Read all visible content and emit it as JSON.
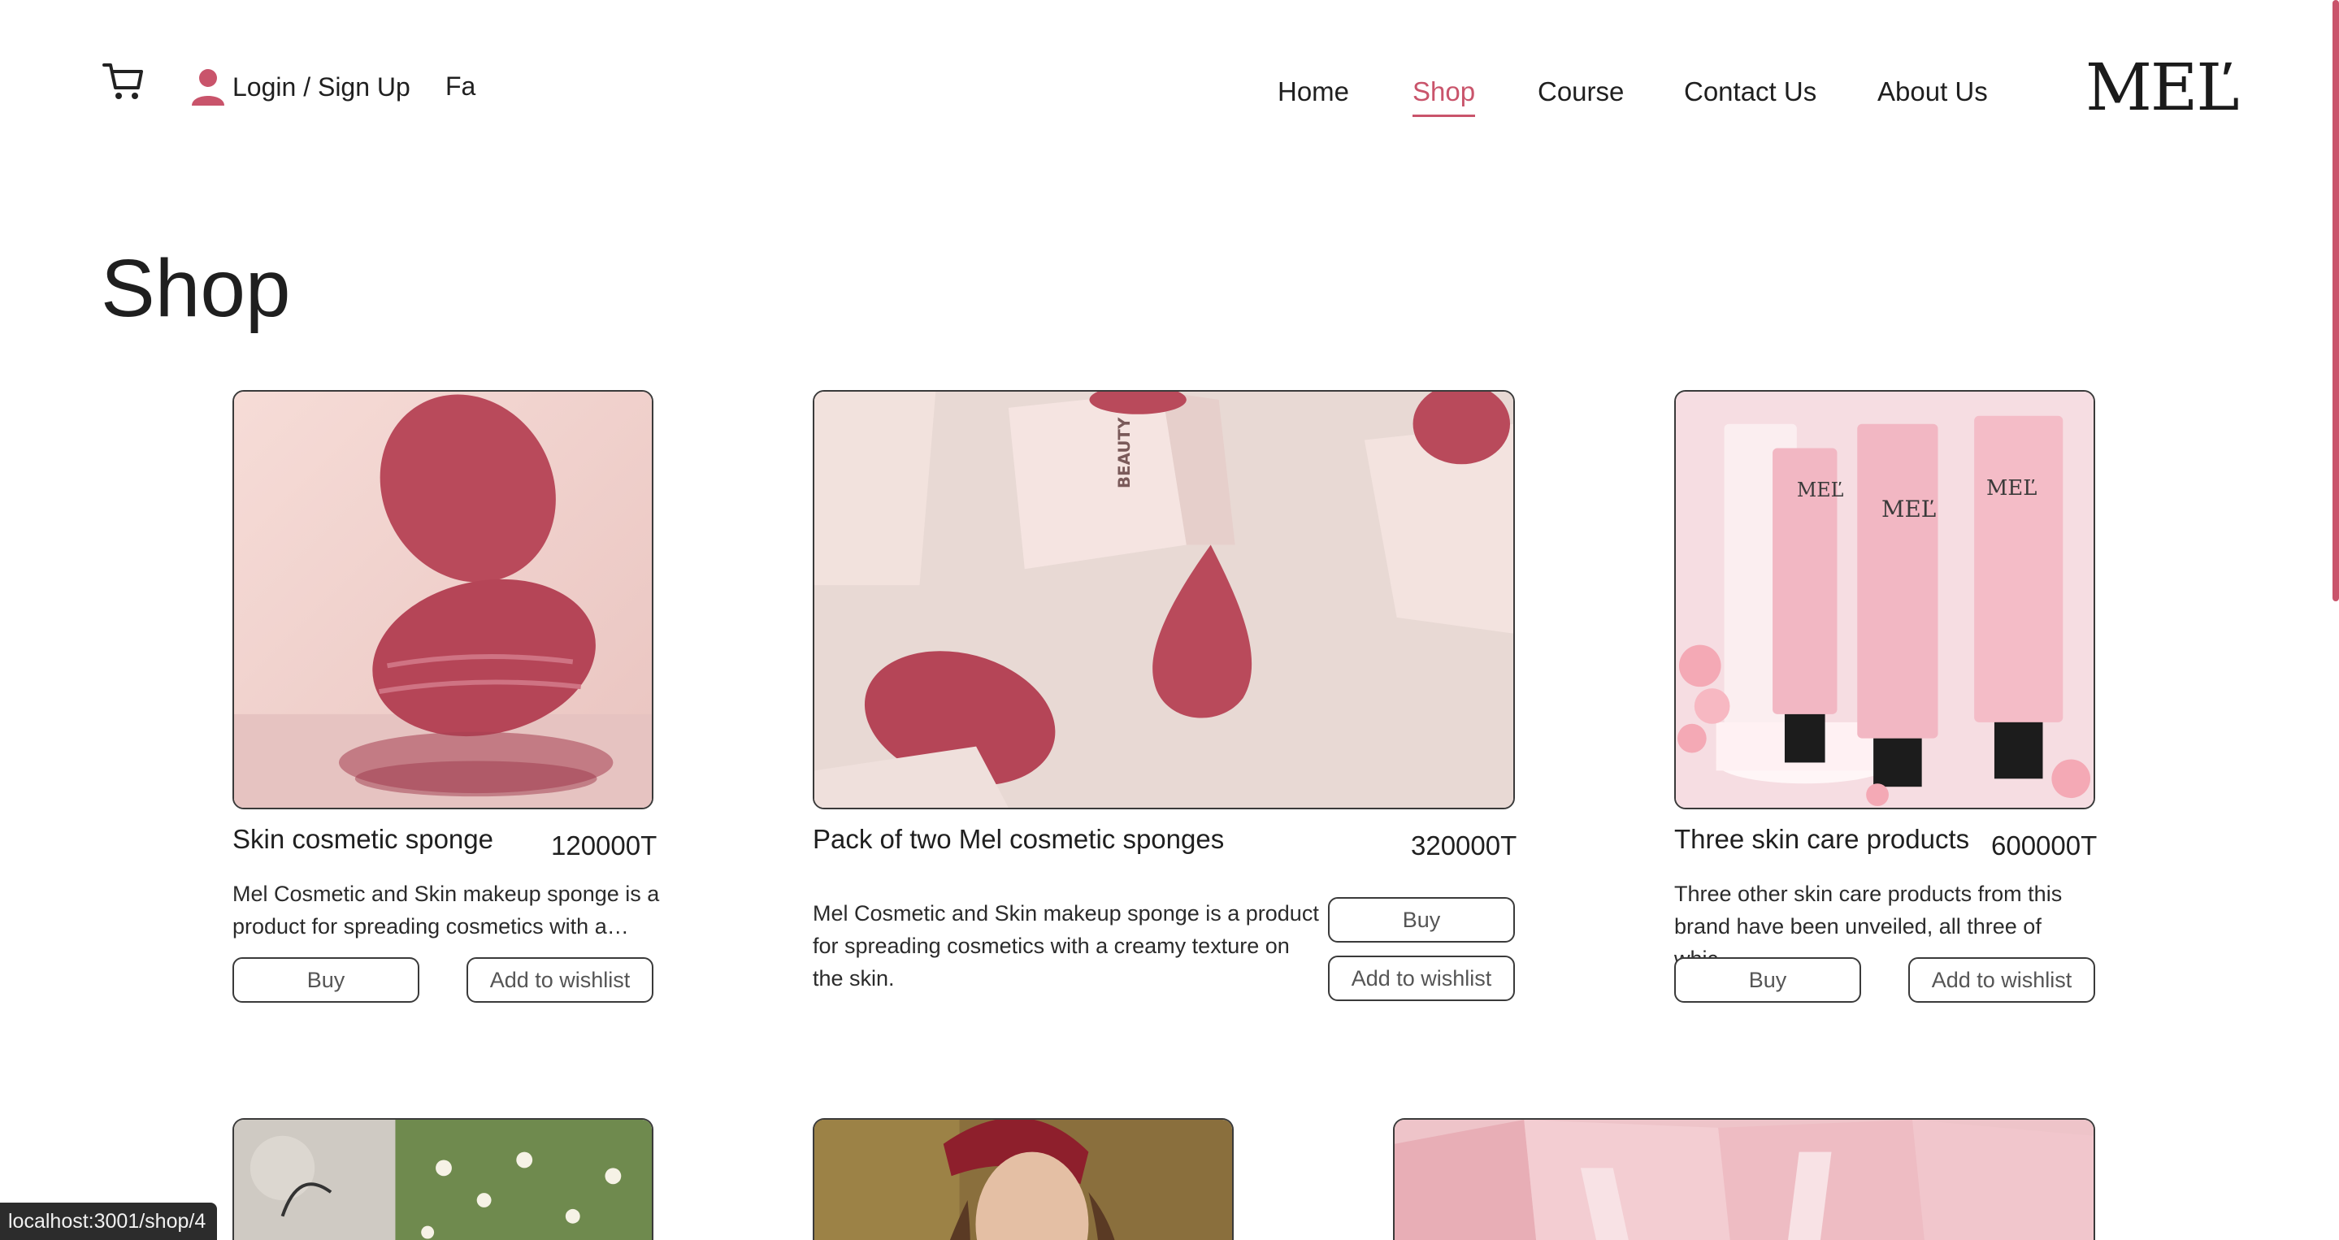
{
  "header": {
    "cart_icon": "cart-icon",
    "user_icon": "user-icon",
    "login_label": "Login / Sign Up",
    "lang_label": "Fa",
    "nav": [
      {
        "label": "Home",
        "active": false
      },
      {
        "label": "Shop",
        "active": true
      },
      {
        "label": "Course",
        "active": false
      },
      {
        "label": "Contact Us",
        "active": false
      },
      {
        "label": "About Us",
        "active": false
      }
    ],
    "logo_text": "MEĽ"
  },
  "page": {
    "title": "Shop"
  },
  "products": [
    {
      "name": "Skin cosmetic sponge",
      "price": "120000T",
      "description": "Mel Cosmetic and Skin makeup sponge is a product for spreading cosmetics with a…",
      "buy_label": "Buy",
      "wishlist_label": "Add to wishlist"
    },
    {
      "name": "Pack of two Mel cosmetic sponges",
      "price": "320000T",
      "description": "Mel Cosmetic and Skin makeup sponge is a product for spreading cosmetics with a creamy texture on the skin.",
      "buy_label": "Buy",
      "wishlist_label": "Add to wishlist",
      "box_text": "BEAUTY SPONGE"
    },
    {
      "name": "Three skin care products",
      "price": "600000T",
      "description": "Three other skin care products from this brand have been unveiled, all three of whic…",
      "buy_label": "Buy",
      "wishlist_label": "Add to wishlist",
      "tube_brand": "MEĽ"
    }
  ],
  "colors": {
    "accent": "#c9546b",
    "sponge": "#b94a5b",
    "pink_bg": "#f3d7d7"
  },
  "status_bar": {
    "url": "localhost:3001/shop/4"
  }
}
